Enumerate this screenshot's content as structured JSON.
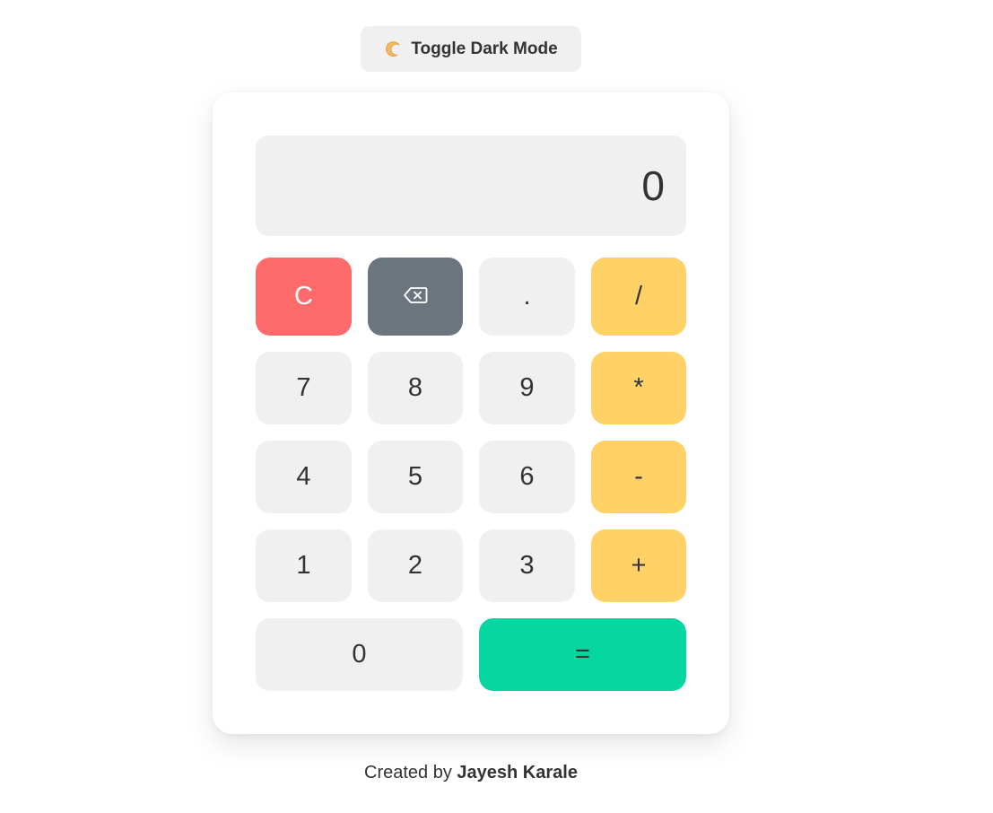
{
  "toggle": {
    "label": "Toggle Dark Mode",
    "icon": "crescent-moon-icon"
  },
  "display": {
    "value": "0"
  },
  "keys": {
    "clear": "C",
    "backspace_icon": "backspace-icon",
    "decimal": ".",
    "divide": "/",
    "seven": "7",
    "eight": "8",
    "nine": "9",
    "multiply": "*",
    "four": "4",
    "five": "5",
    "six": "6",
    "subtract": "-",
    "one": "1",
    "two": "2",
    "three": "3",
    "add": "+",
    "zero": "0",
    "equals": "="
  },
  "footer": {
    "prefix": "Created by",
    "author": "Jayesh Karale"
  },
  "colors": {
    "clear": "#ff6b6b",
    "backspace": "#6c757d",
    "operator": "#ffd166",
    "equals": "#06d6a0",
    "key": "#f0f0f0"
  }
}
